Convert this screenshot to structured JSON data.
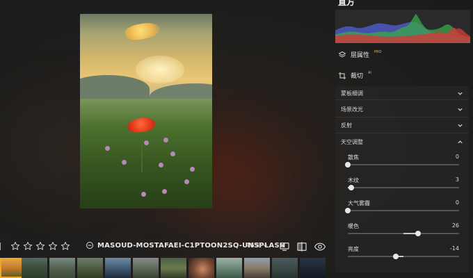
{
  "histogram": {
    "title": "直方"
  },
  "tools": {
    "layer_properties": {
      "label": "层属性",
      "badge": "PRO"
    },
    "crop": {
      "label": "裁切",
      "badge": "AI"
    }
  },
  "accordion": {
    "sections": [
      {
        "label": "蒙板细调",
        "expanded": false
      },
      {
        "label": "场景改光",
        "expanded": false
      },
      {
        "label": "反射",
        "expanded": false
      },
      {
        "label": "天空调整",
        "expanded": true
      }
    ],
    "sky_sliders": [
      {
        "label": "散焦",
        "value": "0",
        "level": 0.0
      },
      {
        "label": "木纹",
        "value": "3",
        "level": 0.03
      },
      {
        "label": "大气雾霾",
        "value": "0",
        "level": 0.0
      },
      {
        "label": "暖色",
        "value": "26",
        "level": 0.63,
        "center": true
      },
      {
        "label": "亮度",
        "value": "-14",
        "level": 0.43,
        "center": true
      }
    ]
  },
  "toolbar": {
    "rating": 0,
    "max_rating": 5,
    "filename": "MASOUD-MOSTAFAEI-C1PTOON2SQ-UNSPLASH",
    "zoom": "46%"
  },
  "filmstrip": {
    "selected_index": 0,
    "count": 12
  },
  "colors": {
    "accent": "#f2a527",
    "panel": "#282828",
    "text": "#d8d8d8"
  }
}
